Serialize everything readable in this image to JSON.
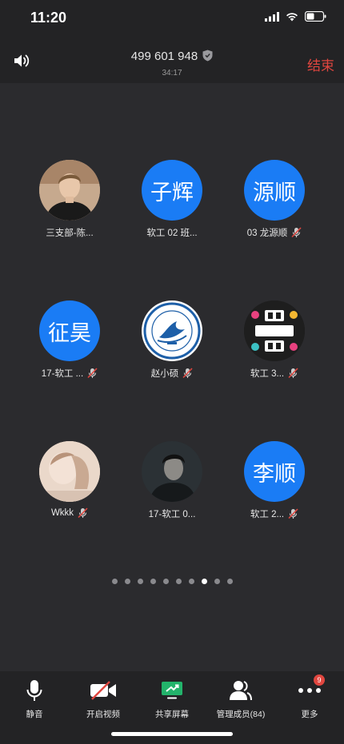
{
  "status_bar": {
    "time": "11:20"
  },
  "header": {
    "meeting_id": "499 601 948",
    "duration": "34:17",
    "end_label": "结束"
  },
  "participants": [
    {
      "name": "三支部-陈...",
      "avatar_type": "photo",
      "avatar_icon": "man-portrait",
      "muted": false
    },
    {
      "name": "软工 02 班...",
      "avatar_type": "text",
      "avatar_text": "子辉",
      "muted": false
    },
    {
      "name": "03 龙源顺",
      "avatar_type": "text",
      "avatar_text": "源顺",
      "muted": true
    },
    {
      "name": "17-软工 ...",
      "avatar_type": "text",
      "avatar_text": "征昊",
      "muted": true
    },
    {
      "name": "赵小硕",
      "avatar_type": "logo",
      "avatar_icon": "university-seal",
      "muted": true
    },
    {
      "name": "软工 3...",
      "avatar_type": "logo",
      "avatar_icon": "go-sports-go-logo",
      "muted": true
    },
    {
      "name": "Wkkk",
      "avatar_type": "photo",
      "avatar_icon": "photo-avatar",
      "muted": true
    },
    {
      "name": "17-软工 0...",
      "avatar_type": "photo",
      "avatar_icon": "dark-portrait",
      "muted": false
    },
    {
      "name": "软工 2...",
      "avatar_type": "text",
      "avatar_text": "李顺",
      "muted": true
    }
  ],
  "pagination": {
    "total": 10,
    "current": 8
  },
  "toolbar": {
    "mute_label": "静音",
    "video_label": "开启视频",
    "share_label": "共享屏幕",
    "members_label": "管理成员(84)",
    "more_label": "更多",
    "more_badge": "9"
  },
  "colors": {
    "accent": "#1a7cf5",
    "danger": "#e0463f",
    "background": "#2b2b2e",
    "bar": "#232325"
  }
}
